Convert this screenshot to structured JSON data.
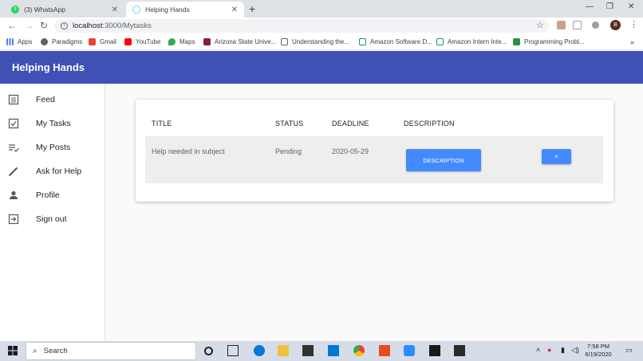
{
  "browser": {
    "tabs": [
      {
        "title": "(3) WhatsApp",
        "badge": "3",
        "active": false
      },
      {
        "title": "Helping Hands",
        "active": true
      }
    ],
    "url_host": "localhost",
    "url_path": ":3000/Mytasks",
    "profile_initial": "B",
    "bookmarks": [
      {
        "label": "Apps",
        "icon": "apps-grid-icon"
      },
      {
        "label": "Paradigms",
        "icon": "globe-icon"
      },
      {
        "label": "Gmail",
        "icon": "gmail-icon"
      },
      {
        "label": "YouTube",
        "icon": "youtube-icon"
      },
      {
        "label": "Maps",
        "icon": "maps-pin-icon"
      },
      {
        "label": "Arizona State Unive...",
        "icon": "asu-icon"
      },
      {
        "label": "Understanding the...",
        "icon": "page-icon"
      },
      {
        "label": "Amazon Software D...",
        "icon": "doc-icon"
      },
      {
        "label": "Amazon Intern Inte...",
        "icon": "doc-icon"
      },
      {
        "label": "Programming Probl...",
        "icon": "gfg-icon"
      }
    ]
  },
  "app": {
    "title": "Helping Hands",
    "accent": "#3f51b5",
    "button_color": "#448aff"
  },
  "sidebar": {
    "items": [
      {
        "label": "Feed",
        "icon": "list-icon"
      },
      {
        "label": "My Tasks",
        "icon": "checkbox-icon"
      },
      {
        "label": "My Posts",
        "icon": "playlist-check-icon"
      },
      {
        "label": "Ask for Help",
        "icon": "pencil-icon"
      },
      {
        "label": "Profile",
        "icon": "person-icon"
      },
      {
        "label": "Sign out",
        "icon": "exit-icon"
      }
    ]
  },
  "tasks_table": {
    "headers": [
      "TITLE",
      "STATUS",
      "DEADLINE",
      "DESCRIPTION"
    ],
    "rows": [
      {
        "title": "Help needed in subject",
        "status": "Pending",
        "deadline": "2020-05-29",
        "description_button": "DESCRIPTION",
        "close_button": "×"
      }
    ]
  },
  "taskbar": {
    "search_placeholder": "Search",
    "time": "7:58 PM",
    "date": "6/19/2020"
  }
}
